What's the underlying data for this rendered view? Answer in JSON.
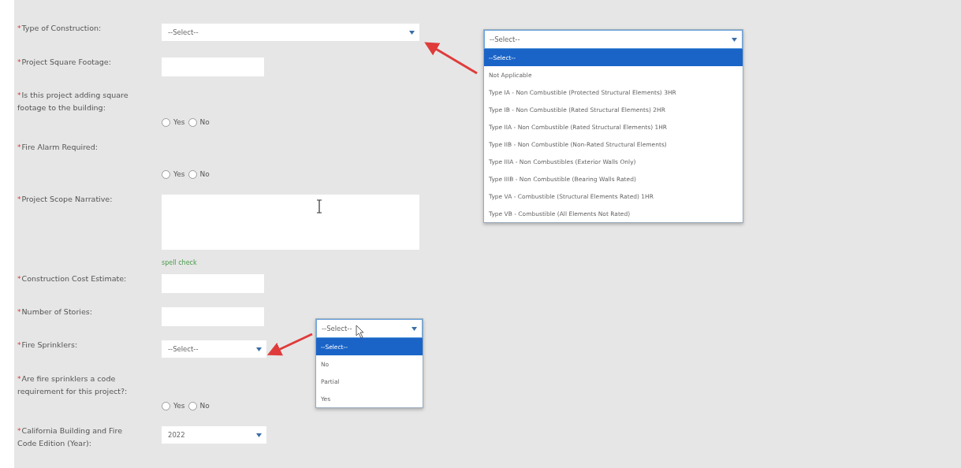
{
  "fields": [
    {
      "kind": "select",
      "mark": "*",
      "label": "Type of Construction:",
      "value": "--Select--"
    },
    {
      "kind": "text",
      "mark": "*",
      "label": "Project Square Footage:"
    },
    {
      "kind": "yesno",
      "mark": "*",
      "label": "Is this project adding square footage to the building:",
      "options": [
        {
          "label": "Yes",
          "selected": false
        },
        {
          "label": "No",
          "selected": false
        }
      ]
    },
    {
      "kind": "yesno",
      "mark": "*",
      "label": "Fire Alarm Required:",
      "options": [
        {
          "label": "Yes",
          "selected": false
        },
        {
          "label": "No",
          "selected": false
        }
      ]
    },
    {
      "kind": "textarea",
      "mark": "*",
      "label": "Project Scope Narrative:",
      "link": "spell check"
    },
    {
      "kind": "text",
      "mark": "*",
      "label": "Construction Cost Estimate:"
    },
    {
      "kind": "text",
      "mark": "*",
      "label": "Number of Stories:"
    },
    {
      "kind": "select",
      "mark": "*",
      "label": "Fire Sprinklers:",
      "value": "--Select--"
    },
    {
      "kind": "yesno",
      "mark": "*",
      "label": "Are fire sprinklers a code requirement for this project?:",
      "options": [
        {
          "label": "Yes",
          "selected": false
        },
        {
          "label": "No",
          "selected": false
        }
      ]
    },
    {
      "kind": "select",
      "mark": "*",
      "label": "California Building and Fire Code Edition (Year):",
      "value": "2022"
    }
  ],
  "open_dropdowns": [
    {
      "value": "--Select--",
      "options": [
        {
          "label": "--Select--",
          "selected": true
        },
        {
          "label": "Not Applicable",
          "selected": false
        },
        {
          "label": "Type IA - Non Combustible (Protected Structural Elements) 3HR",
          "selected": false
        },
        {
          "label": "Type IB - Non Combustible (Rated Structural Elements) 2HR",
          "selected": false
        },
        {
          "label": "Type IIA - Non Combustible (Rated Structural Elements) 1HR",
          "selected": false
        },
        {
          "label": "Type IIB - Non Combustible (Non-Rated Structural Elements)",
          "selected": false
        },
        {
          "label": "Type IIIA - Non Combustibles (Exterior Walls Only)",
          "selected": false
        },
        {
          "label": "Type IIIB - Non Combustible (Bearing Walls Rated)",
          "selected": false
        },
        {
          "label": "Type VA - Combustible (Structural Elements Rated) 1HR",
          "selected": false
        },
        {
          "label": "Type VB - Combustible (All Elements Not Rated)",
          "selected": false
        }
      ]
    },
    {
      "value": "--Select--",
      "options": [
        {
          "label": "--Select--",
          "selected": true
        },
        {
          "label": "No",
          "selected": false
        },
        {
          "label": "Partial",
          "selected": false
        },
        {
          "label": "Yes",
          "selected": false
        }
      ]
    }
  ]
}
